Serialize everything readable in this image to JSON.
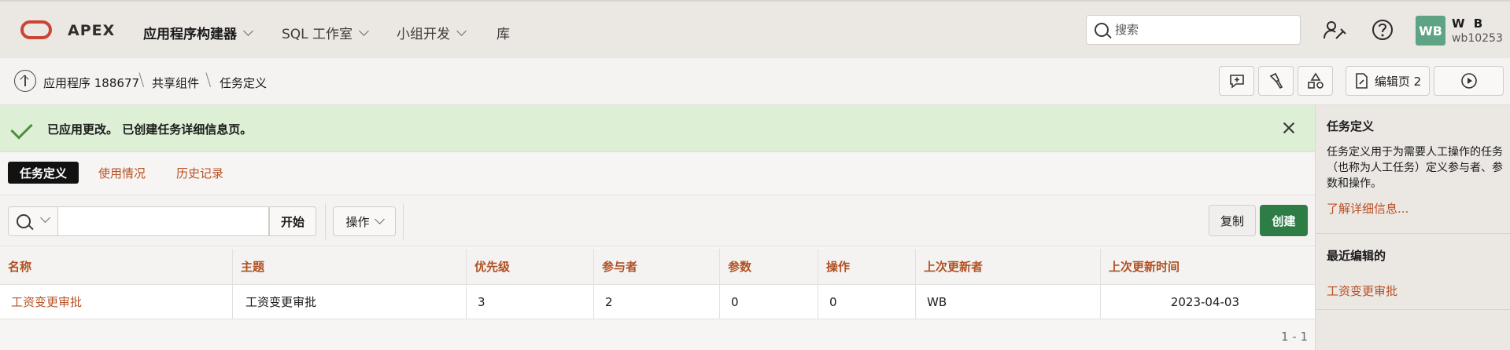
{
  "header": {
    "brand": "APEX",
    "nav": [
      {
        "label": "应用程序构建器"
      },
      {
        "label": "SQL 工作室"
      },
      {
        "label": "小组开发"
      },
      {
        "label": "库"
      }
    ],
    "search_placeholder": "搜索",
    "user_initials": "WB",
    "user_name": "W B",
    "user_id": "wb10253"
  },
  "breadcrumb": {
    "items": [
      "应用程序 188677",
      "共享组件",
      "任务定义"
    ],
    "edit_page_label": "编辑页 2"
  },
  "alert": {
    "message": "已应用更改。 已创建任务详细信息页。"
  },
  "tabs": [
    {
      "label": "任务定义",
      "active": true
    },
    {
      "label": "使用情况",
      "active": false
    },
    {
      "label": "历史记录",
      "active": false
    }
  ],
  "toolbar": {
    "go_label": "开始",
    "actions_label": "操作",
    "copy_label": "复制",
    "create_label": "创建"
  },
  "table": {
    "columns": [
      "名称",
      "主题",
      "优先级",
      "参与者",
      "参数",
      "操作",
      "上次更新者",
      "上次更新时间"
    ],
    "rows": [
      [
        "工资变更审批",
        "工资变更审批",
        "3",
        "2",
        "0",
        "0",
        "WB",
        "2023-04-03"
      ]
    ],
    "pagination": "1 - 1"
  },
  "side_panel": {
    "title": "任务定义",
    "description": "任务定义用于为需要人工操作的任务（也称为人工任务）定义参与者、参数和操作。",
    "learn_more": "了解详细信息...",
    "recent_title": "最近编辑的",
    "recent_items": [
      "工资变更审批"
    ]
  },
  "colors": {
    "brand_red": "#c74634",
    "link": "#b85125",
    "create_green": "#2f7d46",
    "success_bg": "#ddf0d6"
  }
}
